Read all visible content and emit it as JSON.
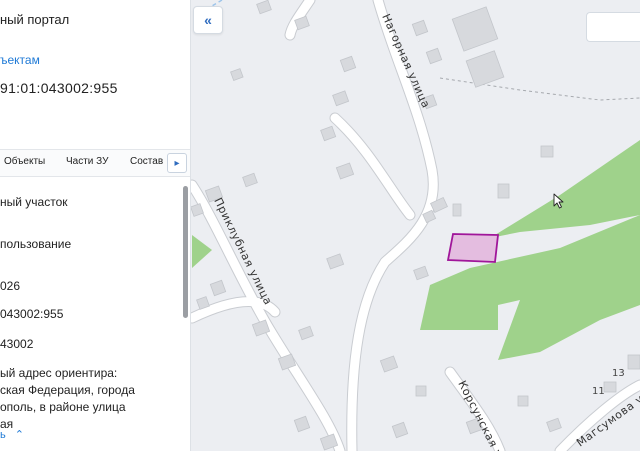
{
  "panel": {
    "title": "ный портал",
    "link": "ъектам",
    "cadastral_number": "91:01:043002:955",
    "tabs": [
      "Объекты",
      "Части ЗУ",
      "Состав"
    ],
    "info_rows": [
      "ный участок",
      "пользование",
      "026",
      "043002:955",
      "43002",
      "ый адрес ориентира:",
      "ская Федерация, города",
      "ополь, в районе улица",
      "ая"
    ],
    "more_link": "ь"
  },
  "map": {
    "streets": {
      "nagornaya": "Нагорная улица",
      "priklubnaya": "Приклубная улица",
      "korsunskaya": "Корсунская у",
      "magsumova": "Магсумова у"
    },
    "house_numbers": [
      "13",
      "11"
    ]
  },
  "colors": {
    "map_background": "#eceef2",
    "road": "#ffffff",
    "building": "#d7d9dd",
    "green_area": "#9fd28b",
    "parcel_fill": "#e4bde0",
    "parcel_stroke": "#a0169a",
    "link": "#1f7ad6",
    "accent": "#2f6cbf"
  },
  "icons": {
    "collapse": "double-chevron-left-icon",
    "tabs_next": "chevron-right-icon",
    "expand_more": "chevron-up-icon",
    "cursor": "mouse-pointer-icon"
  }
}
